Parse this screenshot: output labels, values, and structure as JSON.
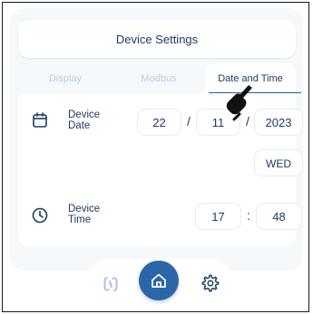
{
  "header": {
    "title": "Device Settings"
  },
  "tabs": [
    {
      "label": "Display"
    },
    {
      "label": "Modbus"
    },
    {
      "label": "Date and Time"
    }
  ],
  "date_row": {
    "label_line1": "Device",
    "label_line2": "Date",
    "day": "22",
    "month": "11",
    "year": "2023",
    "separator": "/",
    "weekday": "WED"
  },
  "time_row": {
    "label_line1": "Device",
    "label_line2": "Time",
    "hour": "17",
    "minute": "48",
    "separator": ":"
  },
  "bottom_nav": {
    "items": [
      "link-icon",
      "home-icon",
      "gear-icon"
    ],
    "active": "home-icon"
  },
  "colors": {
    "accent": "#2b66a8",
    "text": "#1d3b63",
    "inactive_tab": "#bfc9d6",
    "panel_bg": "#f6f9fc"
  }
}
